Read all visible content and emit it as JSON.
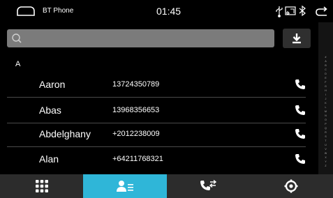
{
  "status_bar": {
    "app_name": "BT Phone",
    "time": "01:45",
    "icons": [
      "car-home-icon",
      "usb-icon",
      "screen-mirror-icon",
      "bluetooth-icon",
      "back-arrow-icon"
    ]
  },
  "search": {
    "placeholder": "",
    "icon": "search-icon"
  },
  "download": {
    "icon": "download-icon"
  },
  "contacts": {
    "section": "A",
    "items": [
      {
        "name": "Aaron",
        "number": "13724350789"
      },
      {
        "name": "Abas",
        "number": "13968356653"
      },
      {
        "name": "Abdelghany",
        "number": "+2012238009"
      },
      {
        "name": "Alan",
        "number": "+64211768321"
      }
    ]
  },
  "alphabet_index": [
    "#",
    "A",
    "B",
    "C",
    "D",
    "E",
    "F",
    "G",
    "H",
    "I",
    "J",
    "K",
    "L",
    "M",
    "N",
    "O",
    "P",
    "Q",
    "R",
    "S",
    "T",
    "U",
    "V",
    "W",
    "X",
    "Y",
    "Z"
  ],
  "bottom_nav": {
    "active_index": 1,
    "tabs": [
      {
        "icon": "dialpad-icon"
      },
      {
        "icon": "contacts-icon"
      },
      {
        "icon": "call-log-icon"
      },
      {
        "icon": "settings-icon"
      }
    ]
  },
  "colors": {
    "accent": "#2fb6d8",
    "background": "#000000",
    "nav_background": "#2c2c2c",
    "search_background": "#7b7b7b"
  }
}
